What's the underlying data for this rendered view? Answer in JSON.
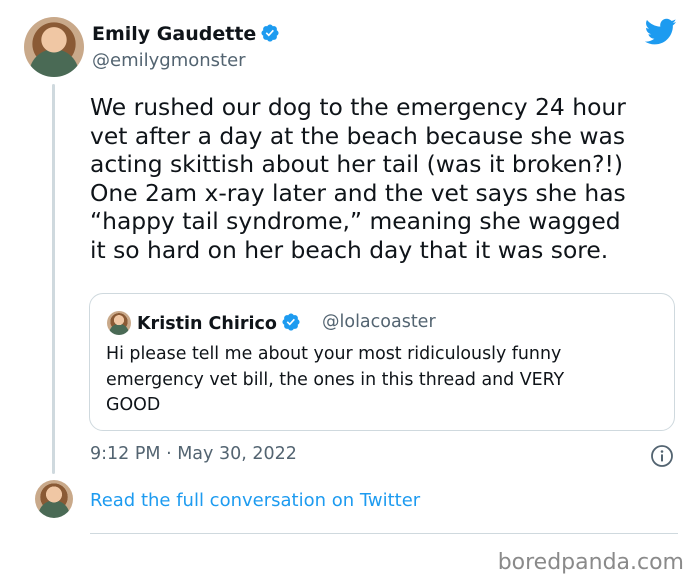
{
  "author": {
    "name": "Emily Gaudette",
    "handle": "@emilygmonster"
  },
  "tweet": {
    "lines": [
      "We rushed our dog to the emergency 24 hour",
      "vet after a day at the beach because she was",
      "acting skittish about her tail (was it broken?!)",
      "One 2am x-ray later and the vet says she has",
      "“happy tail syndrome,” meaning she wagged",
      "it so hard on her beach day that it was sore."
    ]
  },
  "quote": {
    "name": "Kristin Chirico",
    "handle": "@lolacoaster",
    "lines": [
      "Hi please tell me about your most ridiculously funny",
      "emergency vet bill, the ones in this thread and VERY",
      "GOOD"
    ]
  },
  "timestamp": "9:12 PM · May 30, 2022",
  "read_link": "Read the full conversation on Twitter",
  "watermark": "boredpanda.com",
  "colors": {
    "link": "#1d9bf0",
    "verified": "#1d9bf0",
    "muted": "#536471",
    "border": "#cfd9de"
  },
  "icons": [
    "twitter-bird-icon",
    "verified-badge-icon",
    "info-icon"
  ]
}
